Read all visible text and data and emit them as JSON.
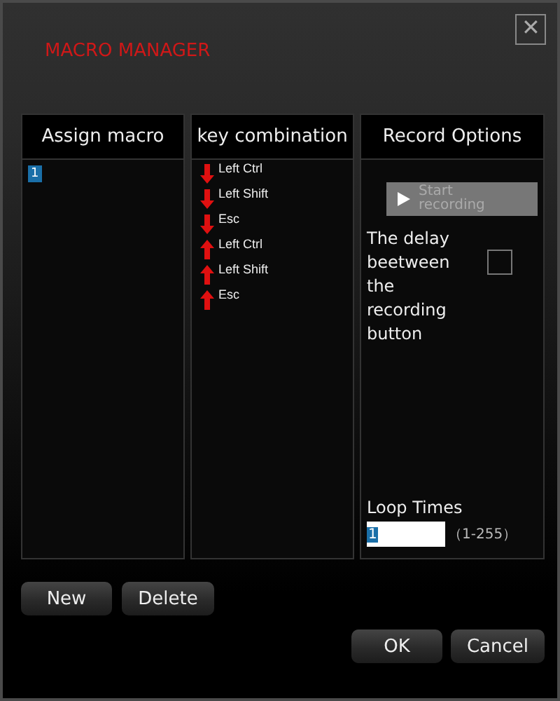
{
  "window": {
    "title": "MACRO MANAGER",
    "close": "✕"
  },
  "columns": [
    "Assign macro",
    "key combination",
    "Record Options"
  ],
  "macros": [
    {
      "label": "1",
      "selected": true
    }
  ],
  "keys": [
    {
      "label": "Left Ctrl",
      "kind": "down"
    },
    {
      "label": "Left Shift",
      "kind": "down"
    },
    {
      "label": "Esc",
      "kind": "down"
    },
    {
      "label": "Left Ctrl",
      "kind": "up"
    },
    {
      "label": "Left Shift",
      "kind": "up"
    },
    {
      "label": "Esc",
      "kind": "up"
    }
  ],
  "record": {
    "button": {
      "label": "Start recording",
      "disabled": true
    },
    "delay": {
      "label": "The delay beetween the recording button",
      "checked": false
    },
    "loop": {
      "label": "Loop Times",
      "value": "1",
      "range": "（1-255）"
    }
  },
  "buttons_left": [
    "New",
    "Delete"
  ],
  "buttons_right": [
    "OK",
    "Cancel"
  ]
}
